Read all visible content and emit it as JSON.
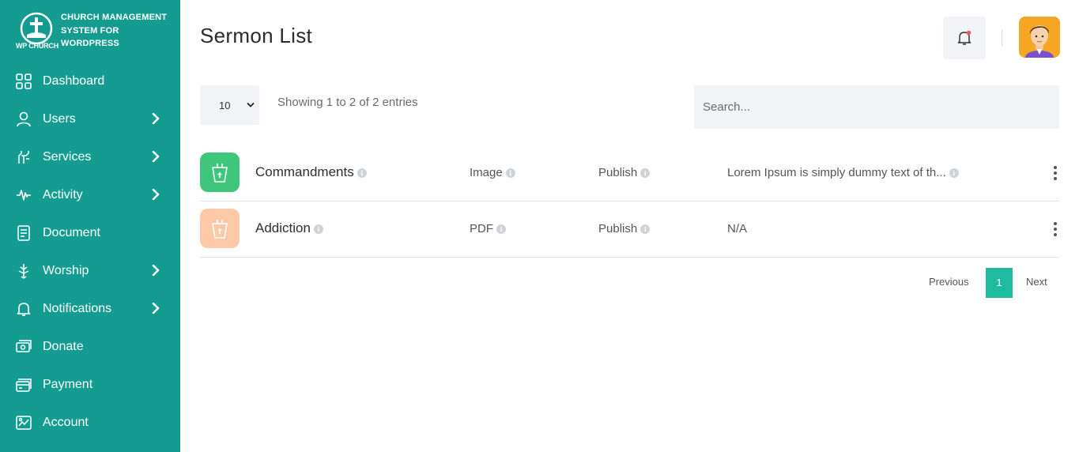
{
  "brand": {
    "name": "CHURCH MANAGEMENT SYSTEM FOR WORDPRESS",
    "logo_text": "WP CHURCH"
  },
  "sidebar": {
    "items": [
      {
        "label": "Dashboard",
        "icon": "dashboard-icon",
        "has_submenu": false
      },
      {
        "label": "Users",
        "icon": "user-icon",
        "has_submenu": true
      },
      {
        "label": "Services",
        "icon": "services-icon",
        "has_submenu": true
      },
      {
        "label": "Activity",
        "icon": "activity-icon",
        "has_submenu": true
      },
      {
        "label": "Document",
        "icon": "document-icon",
        "has_submenu": false
      },
      {
        "label": "Worship",
        "icon": "worship-icon",
        "has_submenu": true
      },
      {
        "label": "Notifications",
        "icon": "bell-icon",
        "has_submenu": true
      },
      {
        "label": "Donate",
        "icon": "donate-icon",
        "has_submenu": false
      },
      {
        "label": "Payment",
        "icon": "payment-icon",
        "has_submenu": false
      },
      {
        "label": "Account",
        "icon": "account-icon",
        "has_submenu": false
      }
    ]
  },
  "header": {
    "title": "Sermon List",
    "bell_icon": "bell-icon",
    "avatar_icon": "user-avatar"
  },
  "toolbar": {
    "page_size": "10",
    "showing_text": "Showing 1 to 2 of 2 entries",
    "search_placeholder": "Search..."
  },
  "rows": [
    {
      "title": "Commandments",
      "type": "Image",
      "status": "Publish",
      "description": "Lorem Ipsum is simply dummy text of th...",
      "thumb_color": "#3ec77a",
      "icon": "podium-icon"
    },
    {
      "title": "Addiction",
      "type": "PDF",
      "status": "Publish",
      "description": "N/A",
      "thumb_color": "#fcc8a6",
      "icon": "podium-icon"
    }
  ],
  "pagination": {
    "previous": "Previous",
    "current": "1",
    "next": "Next"
  },
  "colors": {
    "sidebar_bg": "#149c90",
    "accent": "#1fbba0",
    "notification_dot": "#f05a5a"
  }
}
